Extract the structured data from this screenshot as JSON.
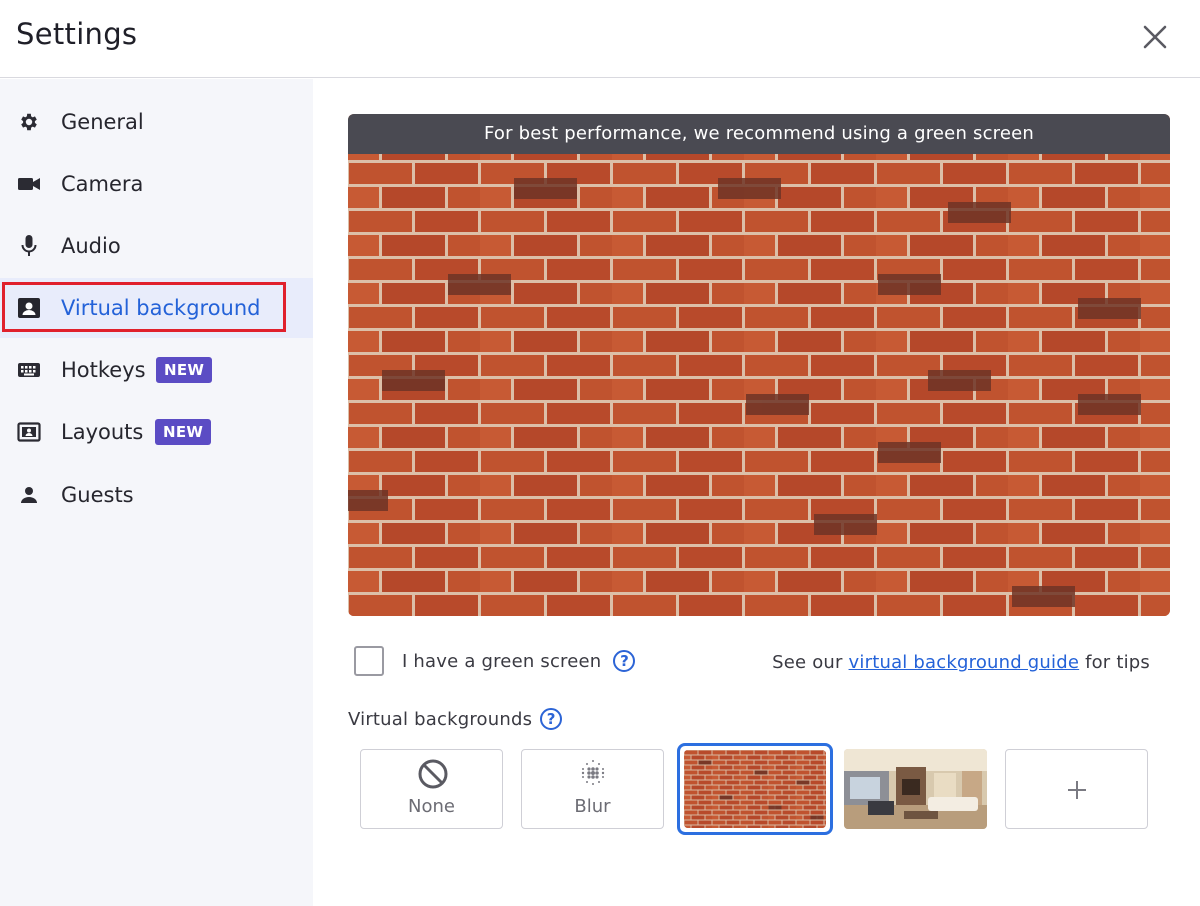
{
  "header": {
    "title": "Settings"
  },
  "sidebar": {
    "items": [
      {
        "label": "General",
        "icon": "gear-icon"
      },
      {
        "label": "Camera",
        "icon": "video-camera-icon"
      },
      {
        "label": "Audio",
        "icon": "microphone-icon"
      },
      {
        "label": "Virtual background",
        "icon": "portrait-icon",
        "active": true
      },
      {
        "label": "Hotkeys",
        "icon": "keyboard-icon",
        "badge": "NEW"
      },
      {
        "label": "Layouts",
        "icon": "layout-icon",
        "badge": "NEW"
      },
      {
        "label": "Guests",
        "icon": "person-icon"
      }
    ]
  },
  "preview": {
    "banner": "For best performance, we recommend using a green screen"
  },
  "green_screen": {
    "label": "I have a green screen",
    "checked": false
  },
  "guide": {
    "prefix": "See our",
    "link": "virtual background guide",
    "suffix": "for tips"
  },
  "backgrounds": {
    "title": "Virtual backgrounds",
    "options": [
      {
        "label": "None",
        "icon": "no-entry-icon"
      },
      {
        "label": "Blur",
        "icon": "blur-icon"
      },
      {
        "label": "Brick wall",
        "selected": true
      },
      {
        "label": "Living room"
      },
      {
        "label": "+",
        "icon": "plus-icon"
      }
    ]
  },
  "colors": {
    "accent": "#2462d8",
    "badge": "#5b4cc4",
    "highlight": "#e0202c",
    "banner": "#4a4a52"
  }
}
